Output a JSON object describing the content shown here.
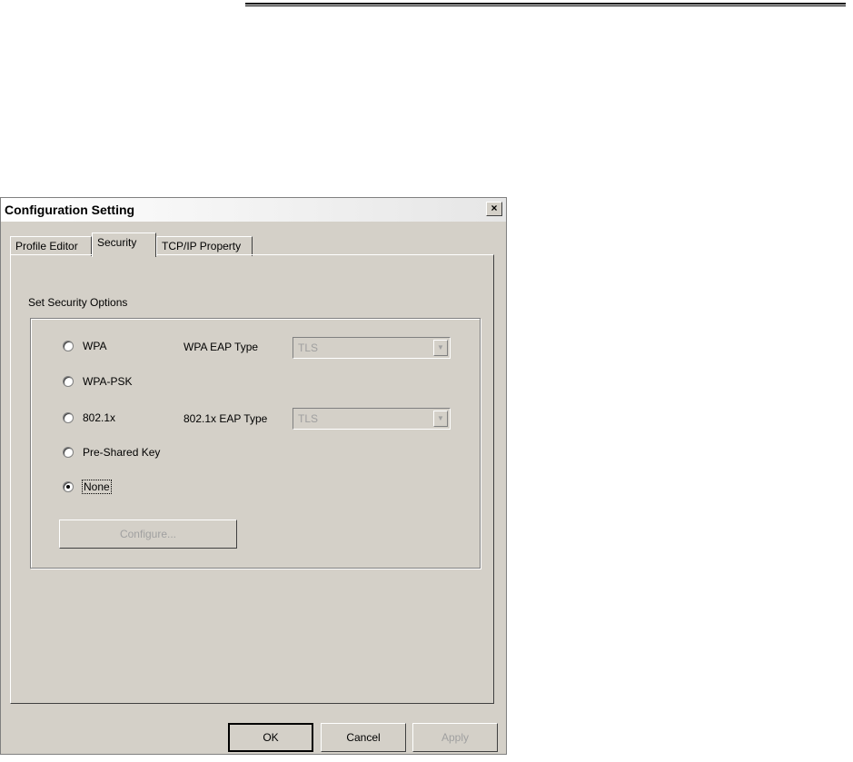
{
  "window": {
    "title": "Configuration Setting",
    "close_symbol": "×"
  },
  "tabs": [
    {
      "label": "Profile Editor",
      "active": false
    },
    {
      "label": "Security",
      "active": true
    },
    {
      "label": "TCP/IP Property",
      "active": false
    }
  ],
  "security": {
    "group_label": "Set Security Options",
    "options": [
      {
        "label": "WPA",
        "checked": false
      },
      {
        "label": "WPA-PSK",
        "checked": false
      },
      {
        "label": "802.1x",
        "checked": false
      },
      {
        "label": "Pre-Shared Key",
        "checked": false
      },
      {
        "label": "None",
        "checked": true
      }
    ],
    "wpa_eap_type": {
      "label": "WPA EAP Type",
      "value": "TLS"
    },
    "dot1x_eap_type": {
      "label": "802.1x EAP Type",
      "value": "TLS"
    },
    "configure_label": "Configure..."
  },
  "buttons": {
    "ok": "OK",
    "cancel": "Cancel",
    "apply": "Apply"
  }
}
